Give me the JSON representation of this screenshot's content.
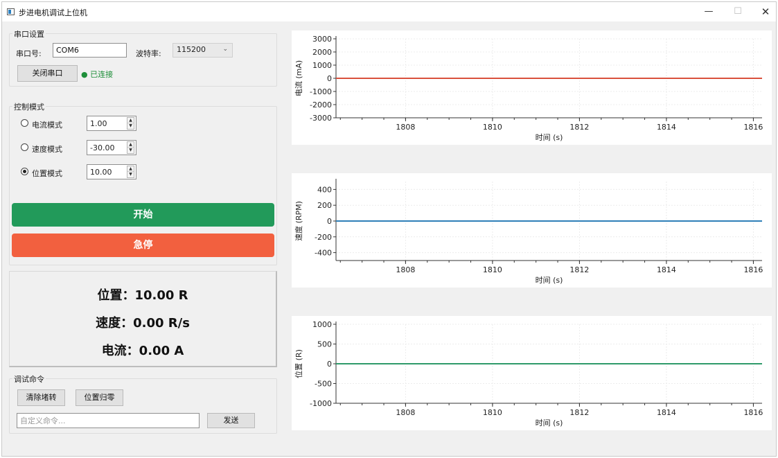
{
  "window": {
    "title": "步进电机调试上位机",
    "minimize": "—",
    "maximize": "☐",
    "close": "✕"
  },
  "serial": {
    "group_title": "串口设置",
    "port_label": "串口号:",
    "port_value": "COM6",
    "baud_label": "波特率:",
    "baud_value": "115200",
    "close_button": "关闭串口",
    "status_text": "● 已连接",
    "status_color": "#1f8f3a"
  },
  "control": {
    "group_title": "控制模式",
    "modes": [
      {
        "label": "电流模式",
        "value": "1.00",
        "checked": false
      },
      {
        "label": "速度模式",
        "value": "-30.00",
        "checked": false
      },
      {
        "label": "位置模式",
        "value": "10.00",
        "checked": true
      }
    ],
    "start_label": "开始",
    "stop_label": "急停",
    "start_color": "#229a5a",
    "stop_color": "#f2603f"
  },
  "readout": {
    "position": "位置：10.00 R",
    "speed": "速度：0.00 R/s",
    "current": "电流：0.00 A"
  },
  "debug": {
    "group_title": "调试命令",
    "clear_stall_button": "清除堵转",
    "zero_position_button": "位置归零",
    "command_placeholder": "自定义命令...",
    "send_button": "发送"
  },
  "chart_data": [
    {
      "type": "line",
      "ylabel": "电流 (mA)",
      "xlabel": "时间 (s)",
      "xlim": [
        1806.4,
        1816.2
      ],
      "ylim": [
        -3000,
        3000
      ],
      "yticks": [
        3000,
        2000,
        1000,
        0,
        -1000,
        -2000,
        -3000
      ],
      "ytick_labels": [
        "3000",
        "2000",
        "1000",
        "0",
        "-1000",
        "-2000",
        "-3000"
      ],
      "xticks": [
        1808,
        1810,
        1812,
        1814,
        1816
      ],
      "xtick_labels": [
        "1808",
        "1810",
        "1812",
        "1814",
        "1816"
      ],
      "series": [
        {
          "color": "#d9503c",
          "x": [
            1806.4,
            1816.2
          ],
          "y": [
            0,
            0
          ]
        }
      ]
    },
    {
      "type": "line",
      "ylabel": "速度 (RPM)",
      "xlabel": "时间 (s)",
      "xlim": [
        1806.4,
        1816.2
      ],
      "ylim": [
        -500,
        500
      ],
      "yticks": [
        400,
        200,
        0,
        -200,
        -400
      ],
      "ytick_labels": [
        "400",
        "200",
        "0",
        "-200",
        "-400"
      ],
      "xticks": [
        1808,
        1810,
        1812,
        1814,
        1816
      ],
      "xtick_labels": [
        "1808",
        "1810",
        "1812",
        "1814",
        "1816"
      ],
      "series": [
        {
          "color": "#2e7fb8",
          "x": [
            1806.4,
            1816.2
          ],
          "y": [
            0,
            0
          ]
        }
      ]
    },
    {
      "type": "line",
      "ylabel": "位置 (R)",
      "xlabel": "时间 (s)",
      "xlim": [
        1806.4,
        1816.2
      ],
      "ylim": [
        -1000,
        1000
      ],
      "yticks": [
        1000,
        500,
        0,
        -500,
        -1000
      ],
      "ytick_labels": [
        "1000",
        "500",
        "0",
        "-500",
        "-1000"
      ],
      "xticks": [
        1808,
        1810,
        1812,
        1814,
        1816
      ],
      "xtick_labels": [
        "1808",
        "1810",
        "1812",
        "1814",
        "1816"
      ],
      "series": [
        {
          "color": "#2e9a6a",
          "x": [
            1806.4,
            1816.2
          ],
          "y": [
            0,
            0
          ]
        }
      ]
    }
  ]
}
